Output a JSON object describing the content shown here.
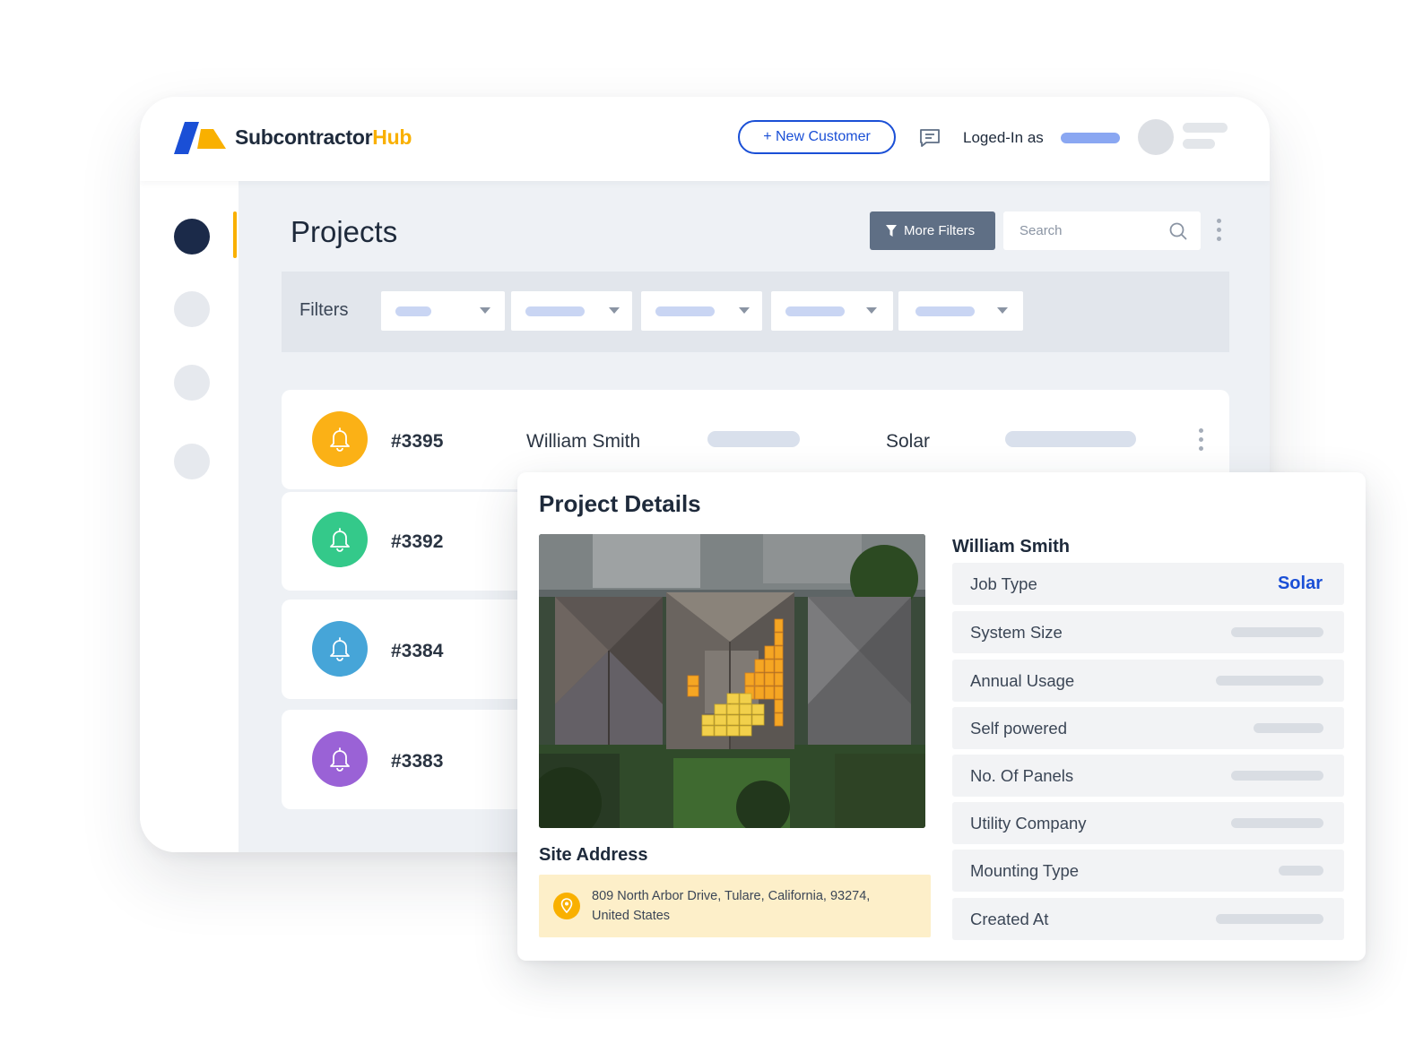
{
  "brand": {
    "name_dark": "Subcontractor",
    "name_accent": "Hub",
    "accent_color": "#f9b000",
    "primary_color": "#1a4fd6",
    "logo_icon": "subcontractor-hub-logo"
  },
  "header": {
    "new_customer_label": "+ New Customer",
    "chat_icon": "chat-icon",
    "logged_in_label": "Loged-In as"
  },
  "page": {
    "title": "Projects"
  },
  "toolbar": {
    "more_filters_label": "More Filters",
    "search_placeholder": "Search"
  },
  "filters": {
    "label": "Filters"
  },
  "projects": [
    {
      "id": "#3395",
      "name": "William Smith",
      "type": "Solar",
      "bell_color": "#fbb116"
    },
    {
      "id": "#3392",
      "name": "",
      "type": "",
      "bell_color": "#34c98a"
    },
    {
      "id": "#3384",
      "name": "",
      "type": "",
      "bell_color": "#46a5d8"
    },
    {
      "id": "#3383",
      "name": "",
      "type": "",
      "bell_color": "#9a62d6"
    }
  ],
  "details": {
    "title": "Project Details",
    "customer_name": "William Smith",
    "site_address_title": "Site Address",
    "address_line1": "809 North Arbor Drive, Tulare, California, 93274,",
    "address_line2": "United States",
    "job_type_label": "Job Type",
    "job_type_value": "Solar",
    "system_size_label": "System Size",
    "annual_usage_label": "Annual Usage",
    "self_powered_label": "Self powered",
    "panels_label": "No. Of Panels",
    "utility_label": "Utility Company",
    "mounting_label": "Mounting Type",
    "created_label": "Created At"
  }
}
